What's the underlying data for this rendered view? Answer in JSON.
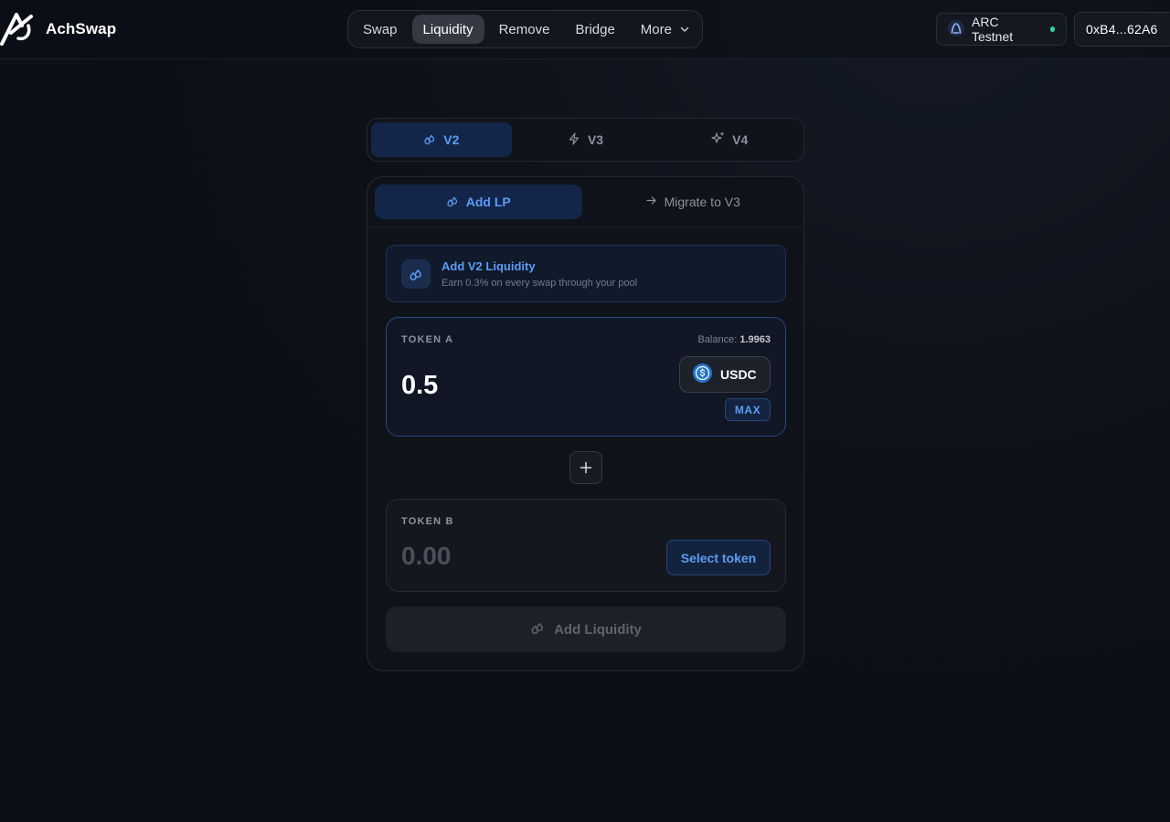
{
  "header": {
    "brand": "AchSwap",
    "nav": [
      {
        "label": "Swap",
        "active": false
      },
      {
        "label": "Liquidity",
        "active": true
      },
      {
        "label": "Remove",
        "active": false
      },
      {
        "label": "Bridge",
        "active": false
      },
      {
        "label": "More",
        "active": false
      }
    ],
    "network": "ARC Testnet",
    "wallet": "0xB4...62A6"
  },
  "version_tabs": [
    {
      "label": "V2",
      "icon": "droplets-icon",
      "active": true
    },
    {
      "label": "V3",
      "icon": "zap-icon",
      "active": false
    },
    {
      "label": "V4",
      "icon": "sparkles-icon",
      "active": false
    }
  ],
  "subtabs": [
    {
      "label": "Add LP",
      "icon": "droplets-icon",
      "active": true
    },
    {
      "label": "Migrate to V3",
      "icon": "arrow-right-icon",
      "active": false
    }
  ],
  "info": {
    "title": "Add V2 Liquidity",
    "subtitle": "Earn 0.3% on every swap through your pool"
  },
  "token_a": {
    "label": "TOKEN A",
    "balance_label": "Balance:",
    "balance_value": "1.9963",
    "amount": "0.5",
    "symbol": "USDC",
    "max_label": "MAX"
  },
  "token_b": {
    "label": "TOKEN B",
    "amount_placeholder": "0.00",
    "select_label": "Select token"
  },
  "submit_label": "Add Liquidity",
  "colors": {
    "accent": "#5b9cf5",
    "accent_bg": "#13264a",
    "status_online": "#34d399",
    "usdc": "#2775ca"
  }
}
